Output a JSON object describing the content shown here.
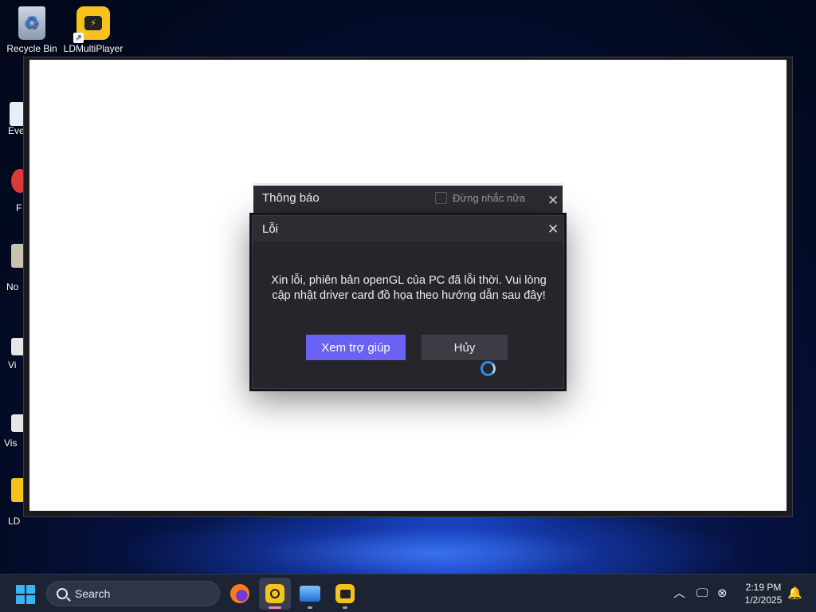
{
  "desktop": {
    "icons": [
      {
        "label": "Recycle Bin",
        "icon": "recycle-bin-icon"
      },
      {
        "label": "LDMultiPlayer",
        "icon": "ldmultiplayer-icon"
      }
    ],
    "partial_labels": [
      "Eve",
      "F",
      "No",
      "Vi",
      "Vis",
      "LD"
    ]
  },
  "dialogs": {
    "notice": {
      "title": "Thông báo",
      "dont_remind_label": "Đừng nhắc nữa",
      "close_icon": "close-icon"
    },
    "error": {
      "title": "Lỗi",
      "message": "Xin lỗi, phiên bản openGL của PC đã lỗi thời. Vui lòng cập nhật driver card đồ họa theo hướng dẫn sau đây!",
      "help_button": "Xem trợ giúp",
      "cancel_button": "Hủy",
      "close_icon": "close-icon"
    }
  },
  "taskbar": {
    "search_placeholder": "Search",
    "apps": [
      {
        "name": "Firefox",
        "icon": "firefox-icon"
      },
      {
        "name": "LDPlayer",
        "icon": "ldplayer-icon"
      },
      {
        "name": "Photos",
        "icon": "photos-icon"
      },
      {
        "name": "LDMultiPlayer",
        "icon": "ldmultiplayer-icon"
      }
    ],
    "clock": {
      "time": "2:19 PM",
      "date": "1/2/2025"
    }
  },
  "colors": {
    "accent_button": "#6a62f2",
    "dialog_bg": "#26252b",
    "spinner": "#2a8ef0"
  }
}
